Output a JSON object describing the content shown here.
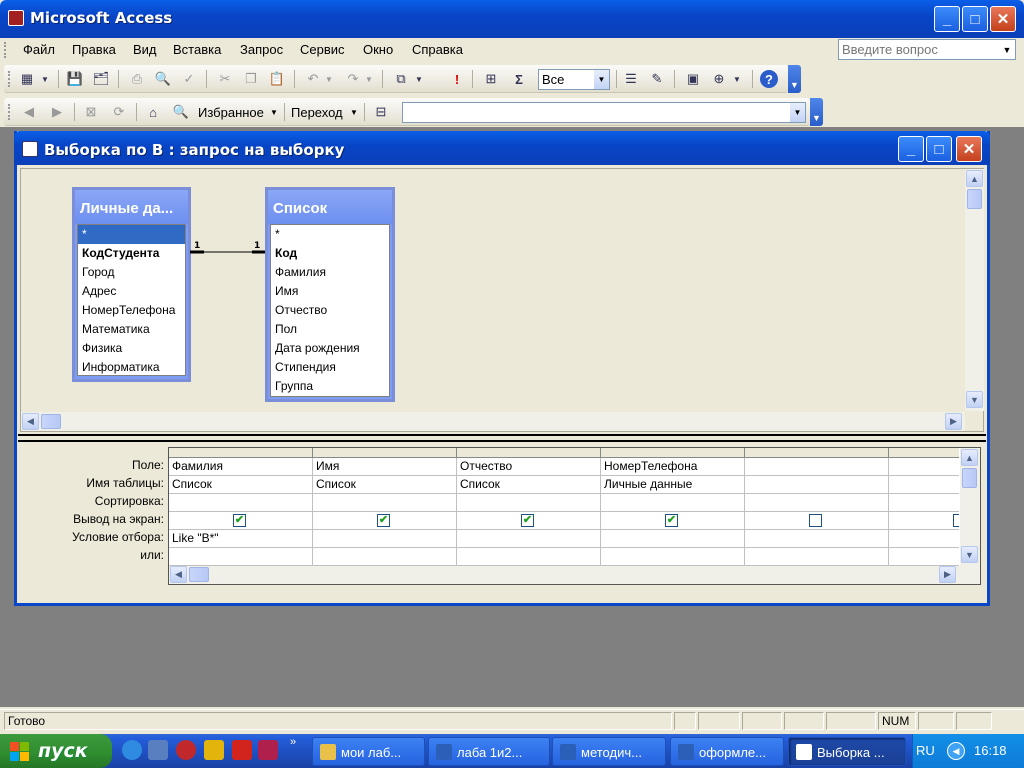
{
  "app": {
    "title": "Microsoft Access"
  },
  "menu": [
    "Файл",
    "Правка",
    "Вид",
    "Вставка",
    "Запрос",
    "Сервис",
    "Окно",
    "Справка"
  ],
  "help_box": {
    "placeholder": "Введите вопрос"
  },
  "toolbar": {
    "top_values": "Все"
  },
  "web_toolbar": {
    "favorites": "Избранное",
    "go": "Переход",
    "address": ""
  },
  "query_window": {
    "title": "Выборка по В : запрос на выборку"
  },
  "tables": [
    {
      "name": "Личные да...",
      "fields": [
        "*",
        "КодСтудента",
        "Город",
        "Адрес",
        "НомерТелефона",
        "Математика",
        "Физика",
        "Информатика"
      ],
      "bold": [
        1
      ],
      "selected": 0
    },
    {
      "name": "Список",
      "fields": [
        "*",
        "Код",
        "Фамилия",
        "Имя",
        "Отчество",
        "Пол",
        "Дата рождения",
        "Стипендия",
        "Группа"
      ],
      "bold": [
        1
      ],
      "selected": -1
    }
  ],
  "relationship": {
    "left": "1",
    "right": "1"
  },
  "qbe": {
    "row_labels": [
      "Поле:",
      "Имя таблицы:",
      "Сортировка:",
      "Вывод на экран:",
      "Условие отбора:",
      "или:"
    ],
    "columns": [
      {
        "field": "Фамилия",
        "table": "Список",
        "sort": "",
        "show": true,
        "criteria": "Like \"В*\"",
        "or": ""
      },
      {
        "field": "Имя",
        "table": "Список",
        "sort": "",
        "show": true,
        "criteria": "",
        "or": ""
      },
      {
        "field": "Отчество",
        "table": "Список",
        "sort": "",
        "show": true,
        "criteria": "",
        "or": ""
      },
      {
        "field": "НомерТелефона",
        "table": "Личные данные",
        "sort": "",
        "show": true,
        "criteria": "",
        "or": ""
      },
      {
        "field": "",
        "table": "",
        "sort": "",
        "show": false,
        "criteria": "",
        "or": ""
      },
      {
        "field": "",
        "table": "",
        "sort": "",
        "show": false,
        "criteria": "",
        "or": ""
      }
    ]
  },
  "status": {
    "text": "Готово",
    "num": "NUM"
  },
  "taskbar": {
    "start": "пуск",
    "tasks": [
      "мои лаб...",
      "лаба 1и2...",
      "методич...",
      "оформле...",
      "Выборка ..."
    ],
    "active": 4,
    "lang": "RU",
    "clock": "16:18"
  },
  "colors": {
    "xp_blue": "#0a46c8",
    "selection": "#316ac5",
    "field_list_header": "#7f9cf4",
    "start_green": "#2f8c2f"
  }
}
